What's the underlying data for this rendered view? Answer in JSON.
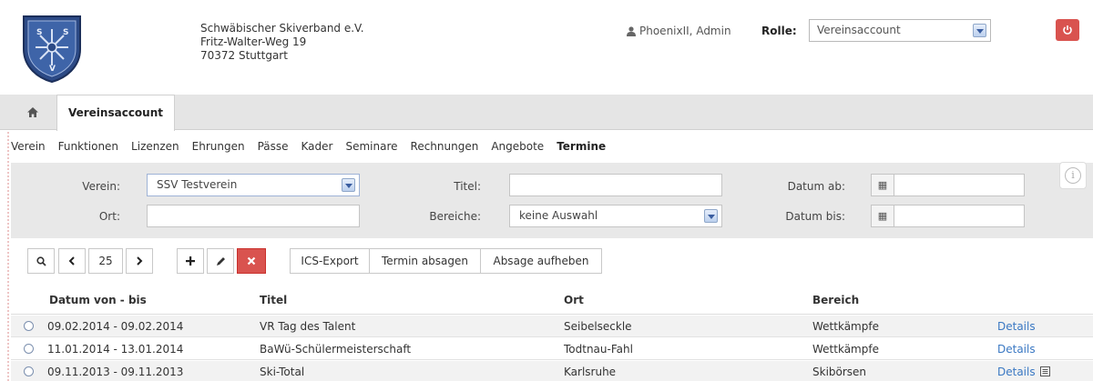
{
  "header": {
    "org_name": "Schwäbischer Skiverband e.V.",
    "street": "Fritz-Walter-Weg 19",
    "city": "70372 Stuttgart",
    "user": "PhoenixII, Admin",
    "role_label": "Rolle:",
    "role_value": "Vereinsaccount",
    "logo_letters": "SSV"
  },
  "tabs": {
    "active": "Vereinsaccount"
  },
  "subnav": {
    "items": [
      "Verein",
      "Funktionen",
      "Lizenzen",
      "Ehrungen",
      "Pässe",
      "Kader",
      "Seminare",
      "Rechnungen",
      "Angebote",
      "Termine"
    ],
    "active_index": 9
  },
  "filter": {
    "verein_label": "Verein:",
    "verein_value": "SSV Testverein",
    "ort_label": "Ort:",
    "ort_value": "",
    "titel_label": "Titel:",
    "titel_value": "",
    "bereiche_label": "Bereiche:",
    "bereiche_value": "keine Auswahl",
    "datum_ab_label": "Datum ab:",
    "datum_bis_label": "Datum bis:"
  },
  "toolbar": {
    "page_size": "25",
    "ics_export": "ICS-Export",
    "cancel_event": "Termin absagen",
    "undo_cancel": "Absage aufheben"
  },
  "table": {
    "columns": [
      "Datum von - bis",
      "Titel",
      "Ort",
      "Bereich"
    ],
    "rows": [
      {
        "datum": "09.02.2014 - 09.02.2014",
        "titel": "VR Tag des Talent",
        "ort": "Seibelseckle",
        "bereich": "Wettkämpfe",
        "link": "Details"
      },
      {
        "datum": "11.01.2014 - 13.01.2014",
        "titel": "BaWü-Schülermeisterschaft",
        "ort": "Todtnau-Fahl",
        "bereich": "Wettkämpfe",
        "link": "Details"
      },
      {
        "datum": "09.11.2013 - 09.11.2013",
        "titel": "Ski-Total",
        "ort": "Karlsruhe",
        "bereich": "Skibörsen",
        "link": "Details"
      }
    ]
  },
  "colors": {
    "accent_red": "#d9534f",
    "link_blue": "#3a78c3",
    "tabbar_gray": "#e5e5e5",
    "filter_gray": "#e8e8e8"
  }
}
